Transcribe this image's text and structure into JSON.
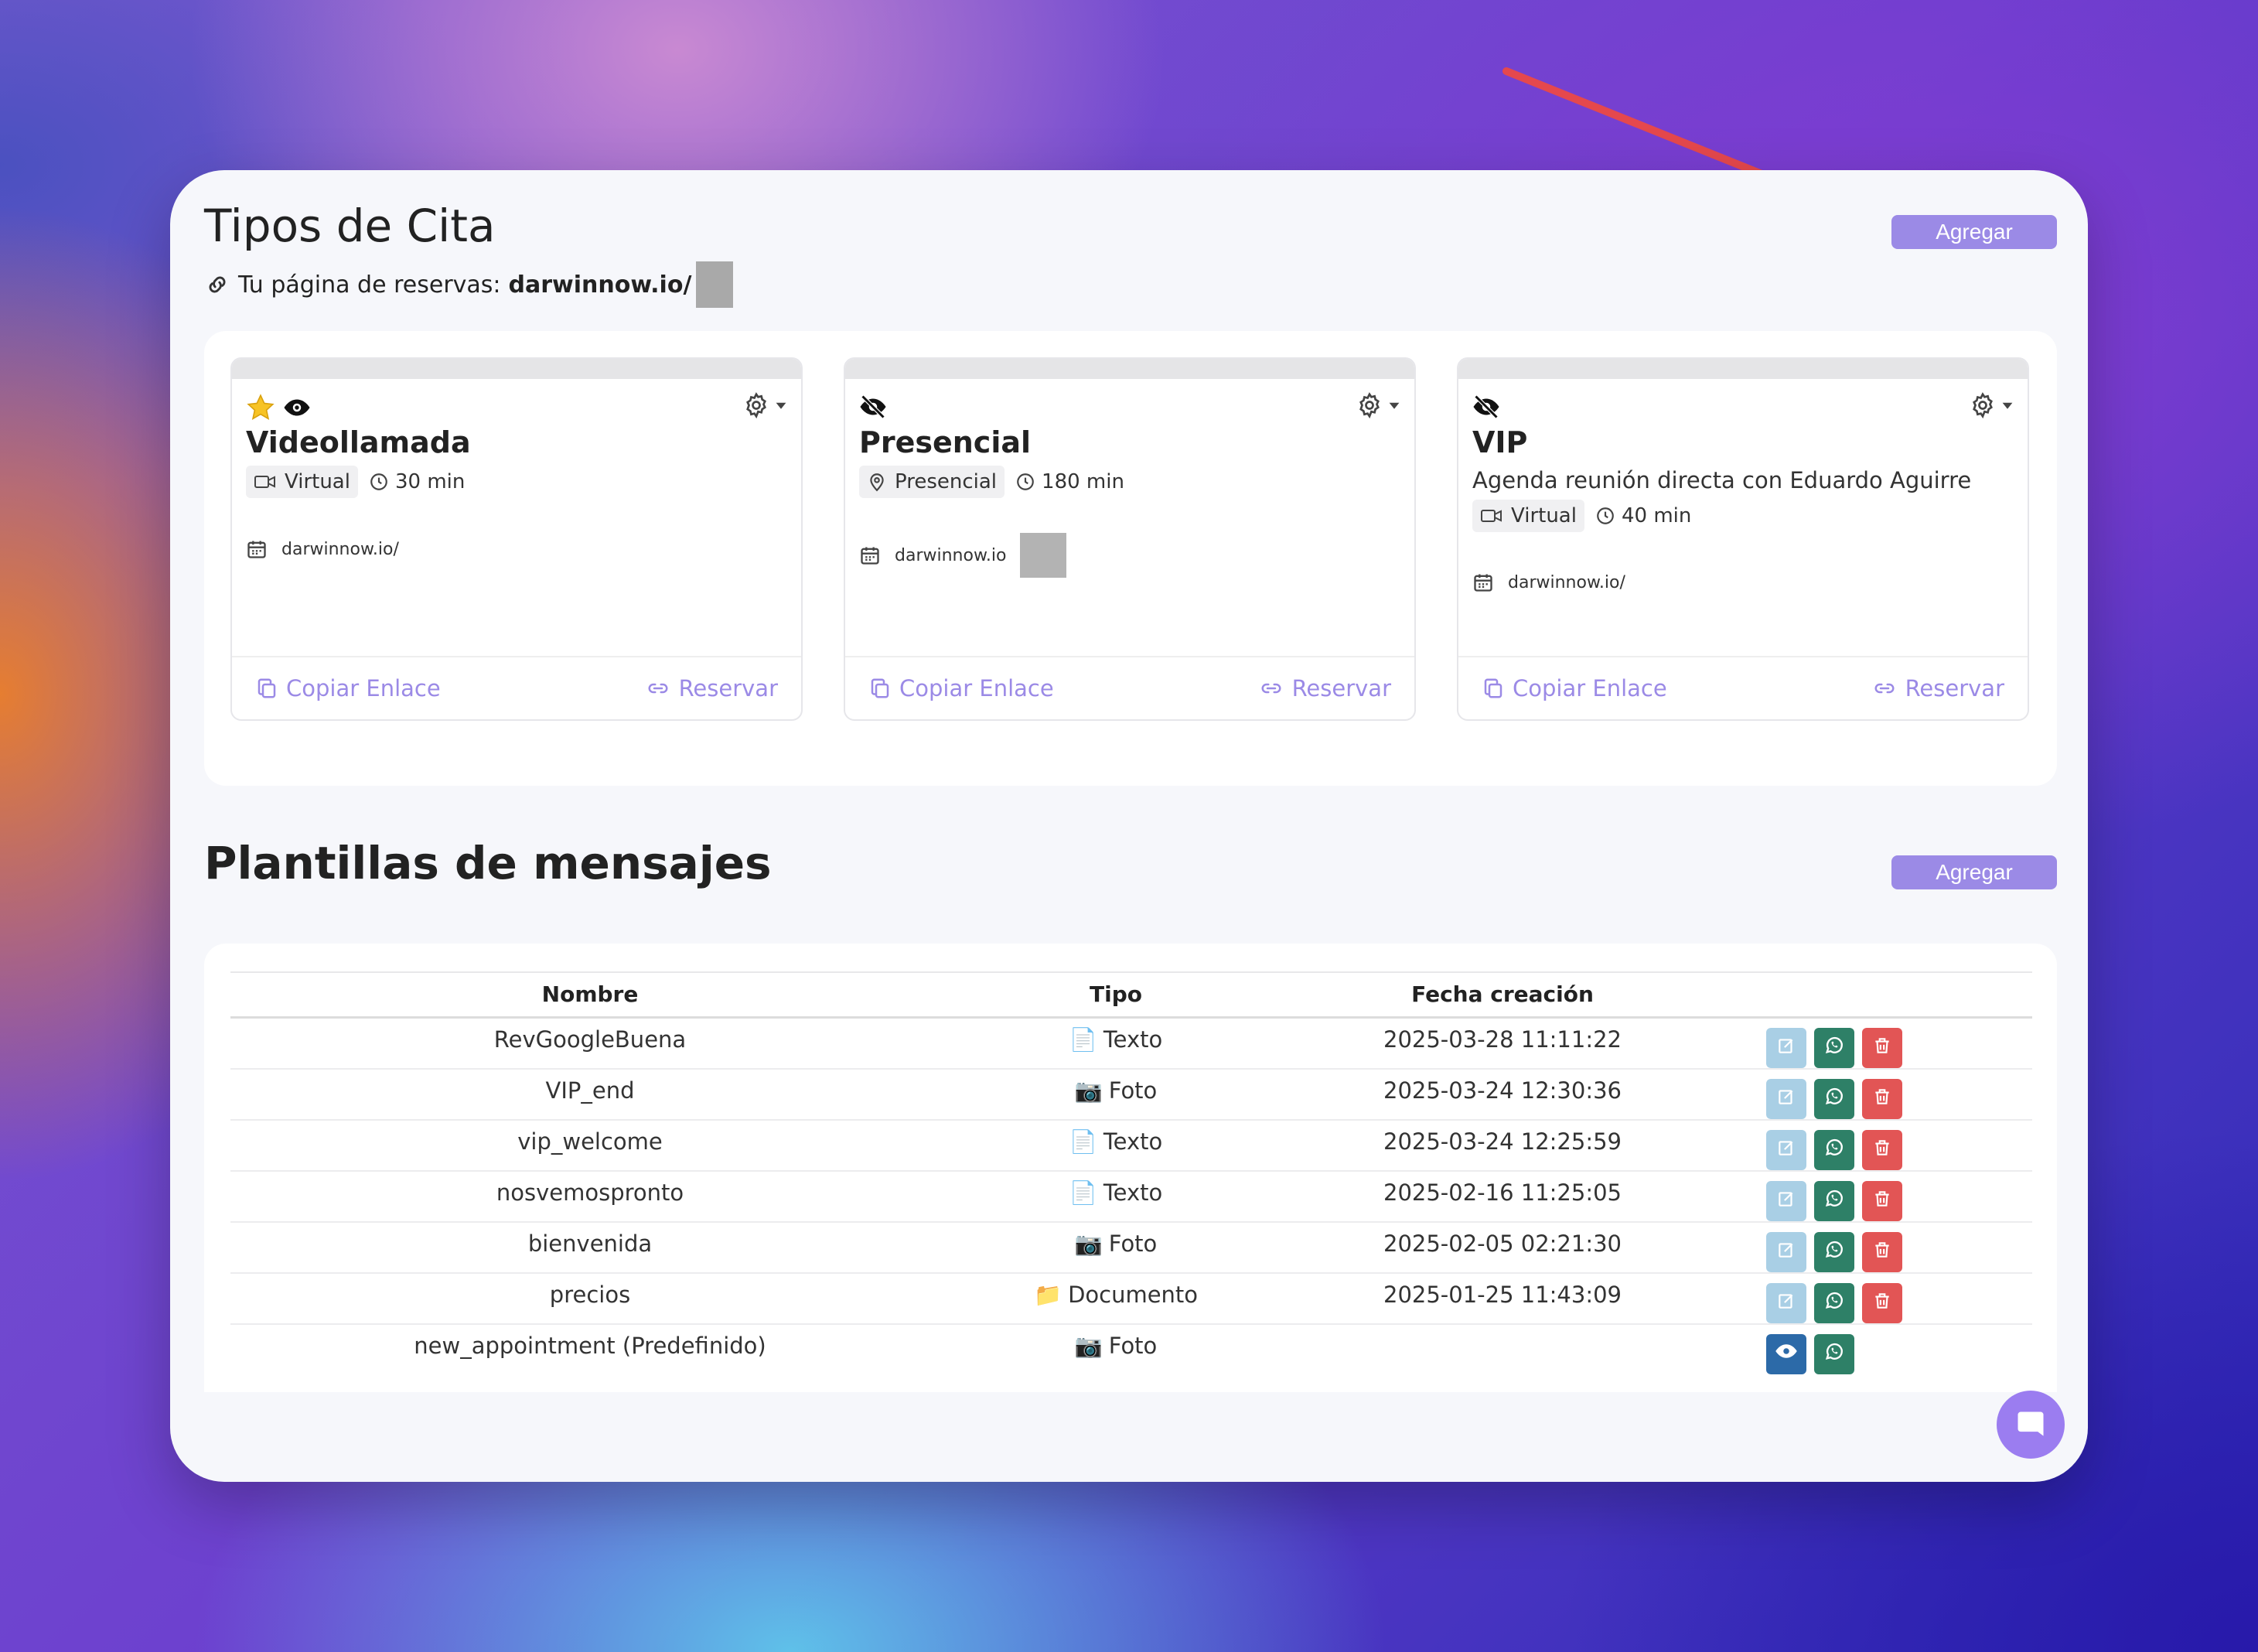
{
  "header": {
    "title": "Tipos de Cita",
    "booking_label": "Tu página de reservas:",
    "booking_url": "darwinnow.io/",
    "add_label": "Agregar"
  },
  "cards": [
    {
      "title": "Videollamada",
      "description": "",
      "mode": "Virtual",
      "duration": "30 min",
      "link": "darwinnow.io/",
      "copy_label": "Copiar Enlace",
      "reserve_label": "Reservar"
    },
    {
      "title": "Presencial",
      "description": "",
      "mode": "Presencial",
      "duration": "180 min",
      "link": "darwinnow.io",
      "copy_label": "Copiar Enlace",
      "reserve_label": "Reservar"
    },
    {
      "title": "VIP",
      "description": "Agenda reunión directa con Eduardo Aguirre",
      "mode": "Virtual",
      "duration": "40 min",
      "link": "darwinnow.io/",
      "copy_label": "Copiar Enlace",
      "reserve_label": "Reservar"
    }
  ],
  "templates": {
    "title": "Plantillas de mensajes",
    "add_label": "Agregar",
    "columns": [
      "Nombre",
      "Tipo",
      "Fecha creación"
    ],
    "rows": [
      {
        "name": "RevGoogleBuena",
        "type_icon": "📄",
        "type": "Texto",
        "date": "2025-03-28 11:11:22"
      },
      {
        "name": "VIP_end",
        "type_icon": "📷",
        "type": "Foto",
        "date": "2025-03-24 12:30:36"
      },
      {
        "name": "vip_welcome",
        "type_icon": "📄",
        "type": "Texto",
        "date": "2025-03-24 12:25:59"
      },
      {
        "name": "nosvemospronto",
        "type_icon": "📄",
        "type": "Texto",
        "date": "2025-02-16 11:25:05"
      },
      {
        "name": "bienvenida",
        "type_icon": "📷",
        "type": "Foto",
        "date": "2025-02-05 02:21:30"
      },
      {
        "name": "precios",
        "type_icon": "📁",
        "type": "Documento",
        "date": "2025-01-25 11:43:09"
      },
      {
        "name": "new_appointment (Predefinido)",
        "type_icon": "📷",
        "type": "Foto",
        "date": ""
      }
    ]
  },
  "colors": {
    "accent": "#9b8ae6",
    "whatsapp": "#2e8067",
    "delete": "#e25555",
    "edit": "#a9cfe5",
    "view": "#2c6aa8",
    "arrow": "#e5484d"
  }
}
